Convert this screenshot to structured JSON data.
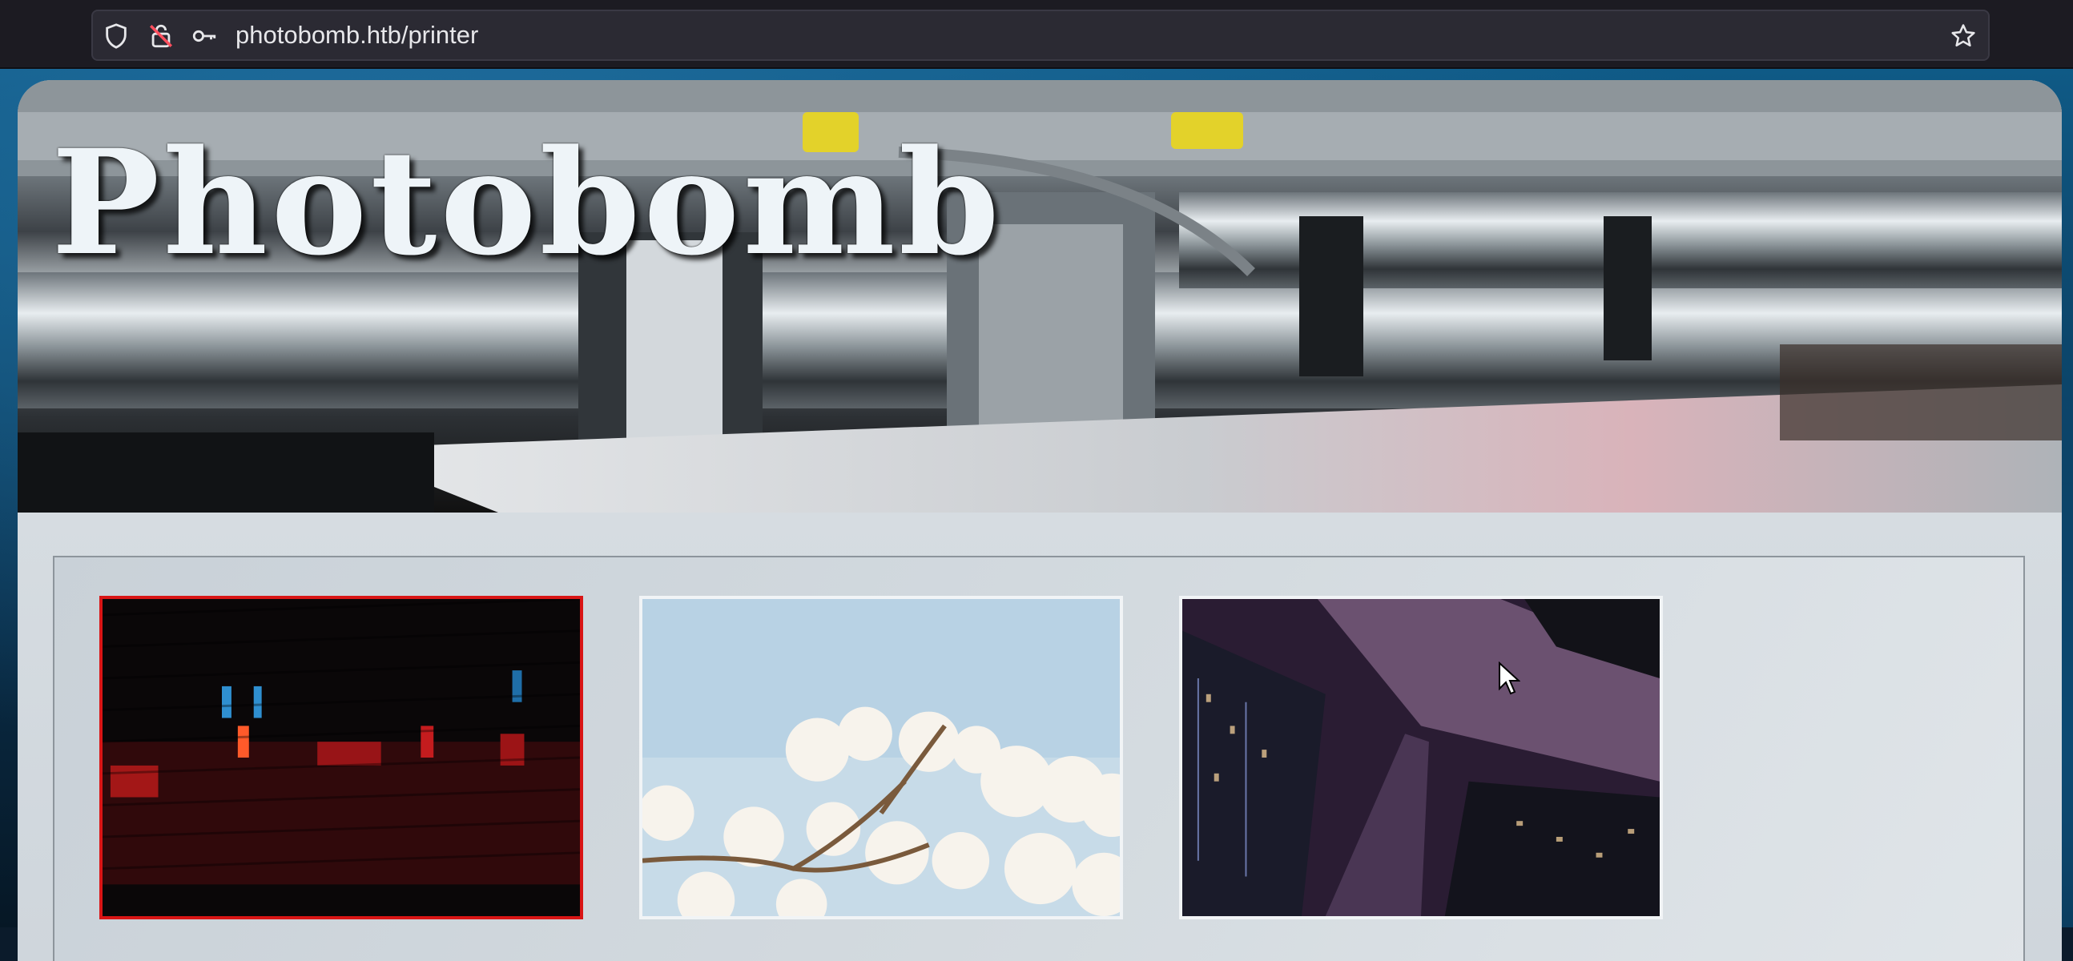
{
  "browser": {
    "url": "photobomb.htb/printer",
    "icons": [
      "shield-icon",
      "insecure-lock-icon",
      "key-icon",
      "bookmark-star-icon"
    ]
  },
  "hero": {
    "title": "Photobomb"
  },
  "gallery": {
    "selected_index": 0,
    "images": [
      {
        "name": "dark-red-blue-lights-photo"
      },
      {
        "name": "white-magnolia-blossoms-photo"
      },
      {
        "name": "city-skyscrapers-night-photo"
      }
    ]
  },
  "colors": {
    "selected_border": "#d91515",
    "thumb_border": "#f1f4f6",
    "title_text": "#eef4f8"
  }
}
